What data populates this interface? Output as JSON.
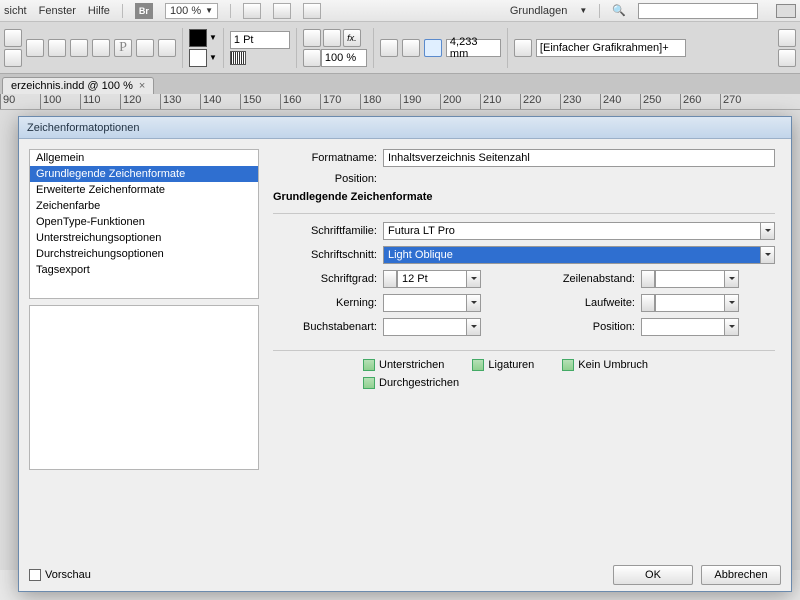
{
  "menu": {
    "items": [
      "sicht",
      "Fenster",
      "Hilfe"
    ],
    "br": "Br",
    "zoom": "100 %",
    "workspace": "Grundlagen",
    "search_placeholder": ""
  },
  "toolbar": {
    "stroke": "1 Pt",
    "pct": "100 %",
    "measure": "4,233 mm",
    "frame": "[Einfacher Grafikrahmen]+"
  },
  "tab": {
    "label": "erzeichnis.indd @ 100 %"
  },
  "ruler": {
    "ticks": [
      "90",
      "100",
      "110",
      "120",
      "130",
      "140",
      "150",
      "160",
      "170",
      "180",
      "190",
      "200",
      "210",
      "220",
      "230",
      "240",
      "250",
      "260",
      "270"
    ]
  },
  "dialog": {
    "title": "Zeichenformatoptionen",
    "categories": [
      "Allgemein",
      "Grundlegende Zeichenformate",
      "Erweiterte Zeichenformate",
      "Zeichenfarbe",
      "OpenType-Funktionen",
      "Unterstreichungsoptionen",
      "Durchstreichungsoptionen",
      "Tagsexport"
    ],
    "selected_index": 1,
    "labels": {
      "formatname": "Formatname:",
      "position": "Position:",
      "section": "Grundlegende Zeichenformate",
      "schriftfamilie": "Schriftfamilie:",
      "schriftschnitt": "Schriftschnitt:",
      "schriftgrad": "Schriftgrad:",
      "zeilenabstand": "Zeilenabstand:",
      "kerning": "Kerning:",
      "laufweite": "Laufweite:",
      "buchstabenart": "Buchstabenart:",
      "pos2": "Position:"
    },
    "values": {
      "formatname": "Inhaltsverzeichnis Seitenzahl",
      "schriftfamilie": "Futura LT Pro",
      "schriftschnitt": "Light Oblique",
      "schriftgrad": "12 Pt",
      "zeilenabstand": "",
      "kerning": "",
      "laufweite": "",
      "buchstabenart": "",
      "pos2": ""
    },
    "checkboxes": {
      "unterstrichen": "Unterstrichen",
      "ligaturen": "Ligaturen",
      "kein_umbruch": "Kein Umbruch",
      "durchgestrichen": "Durchgestrichen"
    },
    "footer": {
      "vorschau": "Vorschau",
      "ok": "OK",
      "abbrechen": "Abbrechen"
    }
  }
}
